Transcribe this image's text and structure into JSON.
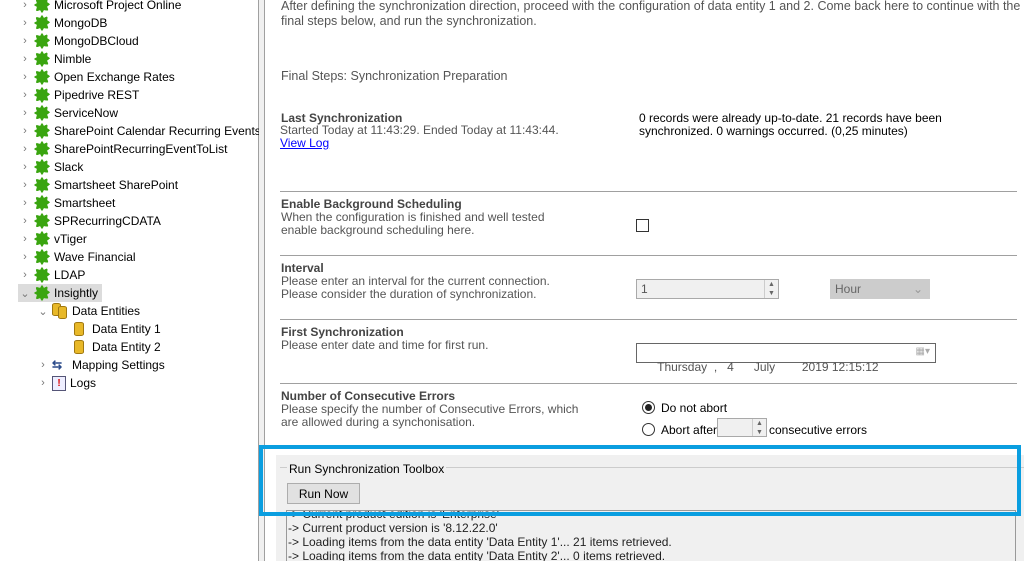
{
  "tree": {
    "items": [
      {
        "label": "Microsoft Project Online",
        "icon": "gear-icon"
      },
      {
        "label": "MongoDB",
        "icon": "gear-icon"
      },
      {
        "label": "MongoDBCloud",
        "icon": "gear-icon"
      },
      {
        "label": "Nimble",
        "icon": "gear-icon"
      },
      {
        "label": "Open Exchange Rates",
        "icon": "gear-icon"
      },
      {
        "label": "Pipedrive REST",
        "icon": "gear-icon"
      },
      {
        "label": "ServiceNow",
        "icon": "gear-icon"
      },
      {
        "label": "SharePoint Calendar Recurring Events",
        "icon": "gear-icon"
      },
      {
        "label": "SharePointRecurringEventToList",
        "icon": "gear-icon"
      },
      {
        "label": "Slack",
        "icon": "gear-icon"
      },
      {
        "label": "Smartsheet SharePoint",
        "icon": "gear-icon"
      },
      {
        "label": "Smartsheet",
        "icon": "gear-icon"
      },
      {
        "label": "SPRecurringCDATA",
        "icon": "gear-icon"
      },
      {
        "label": "vTiger",
        "icon": "gear-icon"
      },
      {
        "label": "Wave Financial",
        "icon": "gear-icon"
      },
      {
        "label": "LDAP",
        "icon": "gear-icon"
      }
    ],
    "selected": {
      "label": "Insightly",
      "icon": "gear-icon"
    },
    "children": {
      "data_entities": "Data Entities",
      "entity1": "Data Entity 1",
      "entity2": "Data Entity 2",
      "mapping": "Mapping Settings",
      "logs": "Logs"
    }
  },
  "main": {
    "intro_line1": "After defining the synchronization direction, proceed with the configuration of data entity 1 and 2. Come back here to continue with the",
    "intro_line2": "final steps below, and run the synchronization.",
    "section_title": "Final Steps: Synchronization Preparation",
    "last_sync": {
      "title": "Last Synchronization",
      "info": "Started  Today at 11:43:29. Ended Today at 11:43:44.",
      "link": "View Log",
      "result1": "0 records were already up-to-date. 21 records have been",
      "result2": "synchronized. 0 warnings occurred. (0,25 minutes)"
    },
    "background": {
      "title": "Enable Background Scheduling",
      "desc1": "When the configuration is finished and well tested",
      "desc2": "enable background scheduling here.",
      "checked": false
    },
    "interval": {
      "title": "Interval",
      "desc1": "Please enter an interval for the current connection.",
      "desc2": "Please consider the duration of synchronization.",
      "value": "1",
      "unit": "Hour"
    },
    "first_sync": {
      "title": "First Synchronization",
      "desc": "Please enter date and time for first run.",
      "value": "Thursday  ,   4      July        2019 12:15:12"
    },
    "errors": {
      "title": "Number of Consecutive Errors",
      "desc1": "Please specify the number of Consecutive Errors, which",
      "desc2": "are allowed during a synchonisation.",
      "opt1": "Do not abort",
      "opt2": "Abort after",
      "suffix": "consecutive errors",
      "selected": "Do not abort"
    },
    "toolbox": {
      "title": "Run Synchronization Toolbox",
      "run": "Run Now"
    },
    "log": [
      "-> Current product edition is 'Enterprise'",
      "-> Current product version is '8.12.22.0'",
      "-> Loading items from the data entity 'Data Entity 1'... 21 items retrieved.",
      "-> Loading items from the data entity 'Data Entity 2'... 0 items retrieved."
    ]
  },
  "colors": {
    "highlight": "#0a9ee0",
    "gear": "#3aa510"
  }
}
